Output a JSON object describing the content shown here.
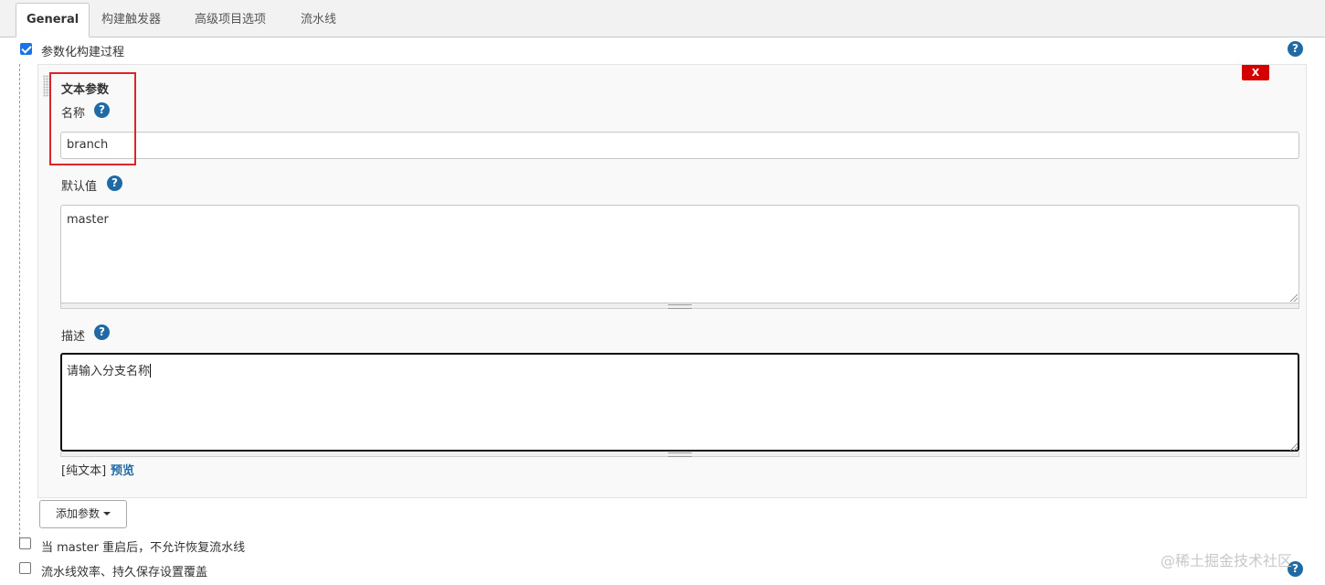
{
  "tabs": [
    {
      "label": "General",
      "active": true
    },
    {
      "label": "构建触发器"
    },
    {
      "label": "高级项目选项"
    },
    {
      "label": "流水线"
    }
  ],
  "parameterized": {
    "label": "参数化构建过程",
    "checked": true
  },
  "help_glyph": "?",
  "param": {
    "type_title": "文本参数",
    "name_label": "名称",
    "name_value": "branch",
    "default_label": "默认值",
    "default_value": "master",
    "desc_label": "描述",
    "desc_value": "请输入分支名称",
    "delete_label": "X",
    "plain_text_label": "[纯文本]",
    "preview_link": "预览"
  },
  "add_param_button": "添加参数",
  "options": [
    {
      "label": "当 master 重启后，不允许恢复流水线",
      "checked": false
    },
    {
      "label": "流水线效率、持久保存设置覆盖",
      "checked": false
    }
  ],
  "watermark": "@稀土掘金技术社区",
  "colors": {
    "help_icon": "#1f6aa5",
    "delete_button": "#d40000",
    "highlight_box": "#d9262c",
    "checkbox_checked": "#1a73e8"
  }
}
